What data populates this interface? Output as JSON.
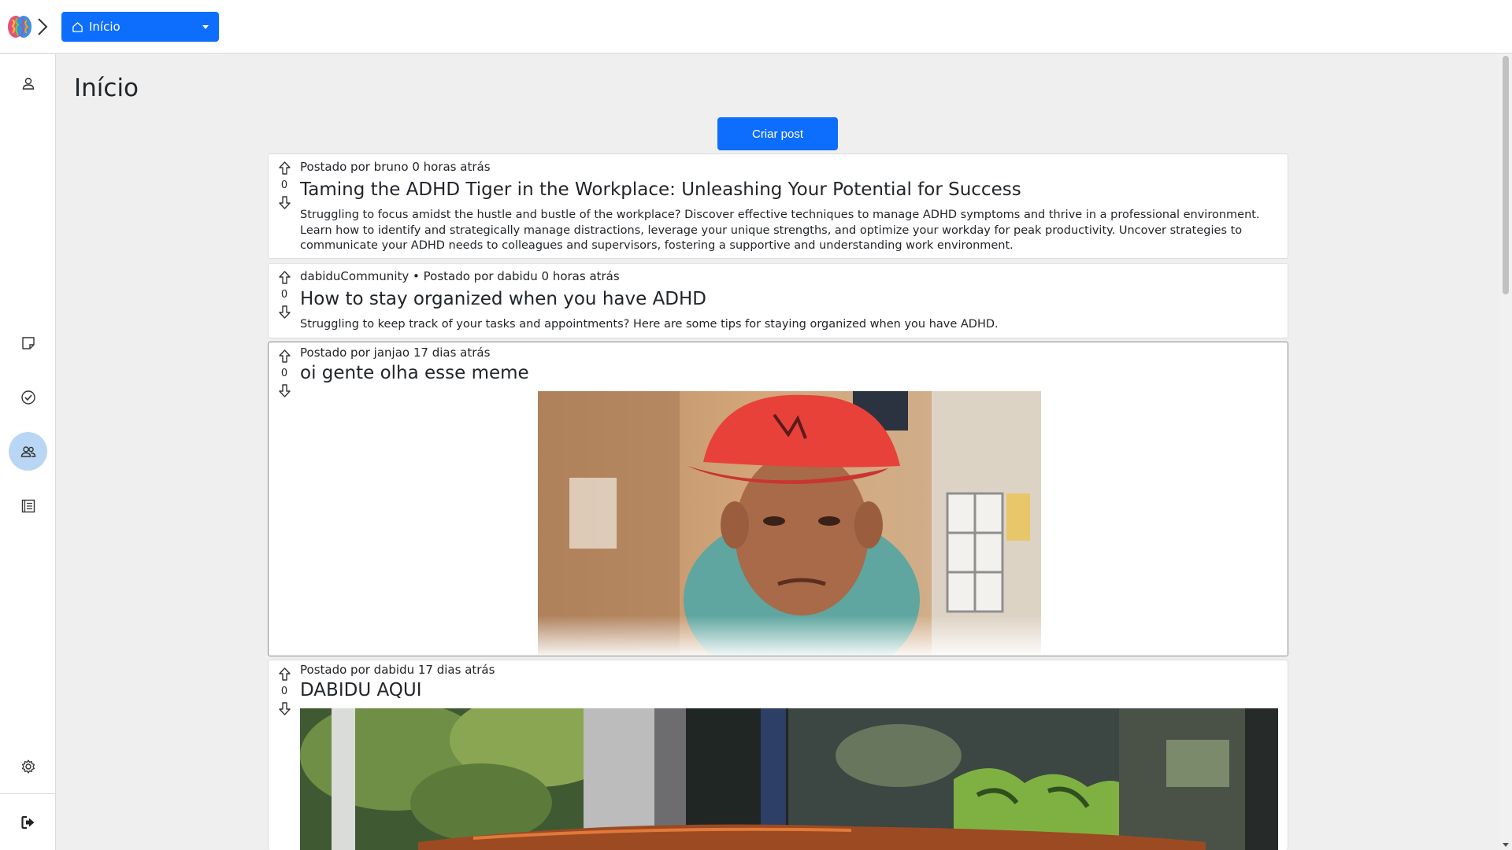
{
  "header": {
    "nav_label": "Início",
    "logo_icon": "brain-icon",
    "expand_icon": "chevron-right-icon",
    "accent_color": "#0d6efd"
  },
  "sidebar": {
    "items": [
      {
        "name": "profile",
        "icon": "user-icon",
        "active": false
      },
      {
        "name": "notes",
        "icon": "sticky-note-icon",
        "active": false
      },
      {
        "name": "tasks",
        "icon": "check-circle-icon",
        "active": false
      },
      {
        "name": "community",
        "icon": "users-icon",
        "active": true
      },
      {
        "name": "journal",
        "icon": "list-document-icon",
        "active": false
      },
      {
        "name": "settings",
        "icon": "gear-icon",
        "active": false
      },
      {
        "name": "logout",
        "icon": "logout-icon",
        "active": false
      }
    ]
  },
  "main": {
    "title": "Início",
    "create_button": "Criar post"
  },
  "posts": [
    {
      "meta": "Postado por bruno 0 horas atrás",
      "votes": "0",
      "title": "Taming the ADHD Tiger in the Workplace: Unleashing Your Potential for Success",
      "body": "Struggling to focus amidst the hustle and bustle of the workplace? Discover effective techniques to manage ADHD symptoms and thrive in a professional environment. Learn how to identify and strategically manage distractions, leverage your unique strengths, and optimize your workday for peak productivity. Uncover strategies to communicate your ADHD needs to colleagues and supervisors, fostering a supportive and understanding work environment."
    },
    {
      "meta": "dabiduCommunity • Postado por dabidu 0 horas atrás",
      "votes": "0",
      "title": "How to stay organized when you have ADHD",
      "body": "Struggling to keep track of your tasks and appointments? Here are some tips for staying organized when you have ADHD."
    },
    {
      "meta": "Postado por janjao 17 dias atrás",
      "votes": "0",
      "title": "oi gente olha esse meme",
      "image": "meme-photo"
    },
    {
      "meta": "Postado por dabidu 17 dias atrás",
      "votes": "0",
      "title": "DABIDU AQUI",
      "image": "car-photo"
    }
  ]
}
